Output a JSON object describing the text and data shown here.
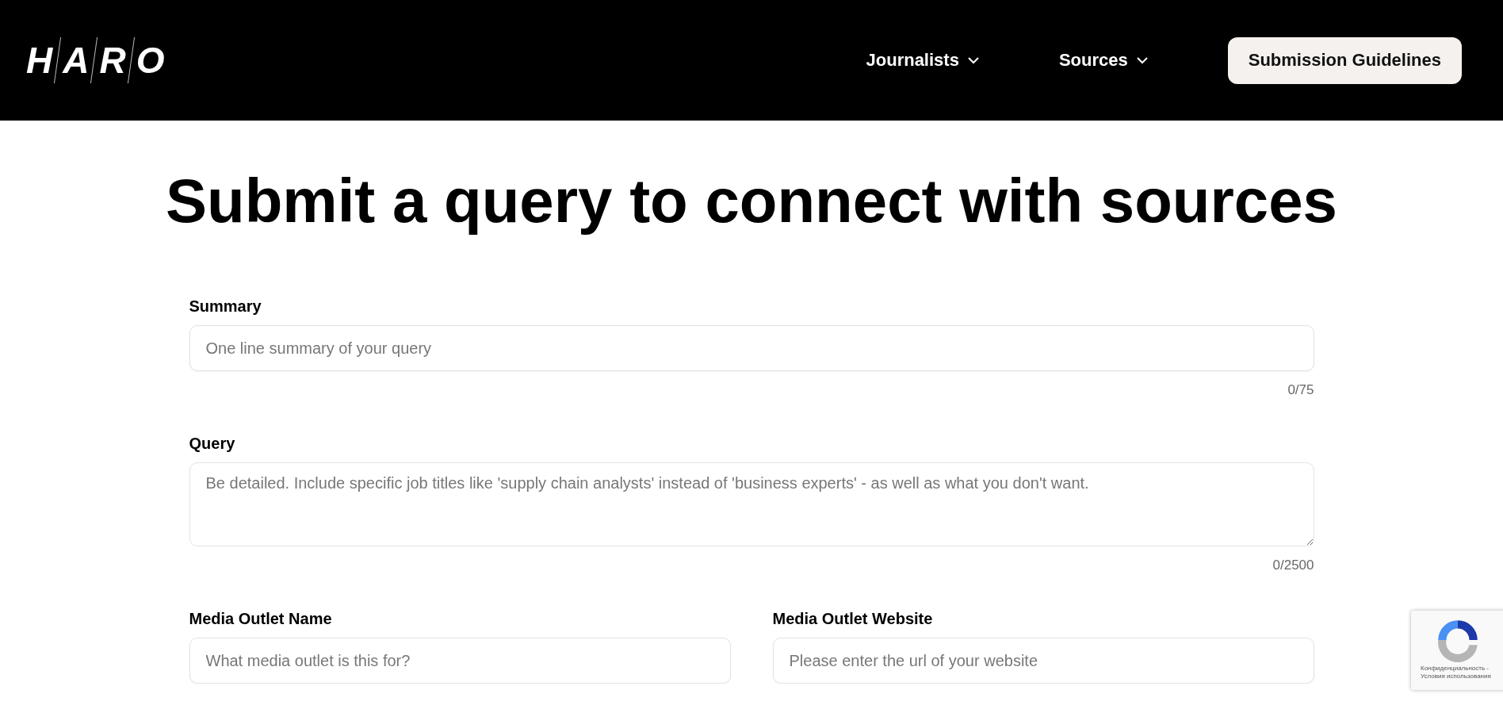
{
  "header": {
    "logo_letters": [
      "H",
      "A",
      "R",
      "O"
    ],
    "nav": [
      {
        "label": "Journalists",
        "kind": "dropdown"
      },
      {
        "label": "Sources",
        "kind": "dropdown"
      },
      {
        "label": "Submission Guidelines",
        "kind": "button"
      }
    ]
  },
  "title": "Submit a query to connect with sources",
  "fields": [
    {
      "kind": "input",
      "label": "Summary",
      "placeholder": "One line summary of your query",
      "counter": "0/75"
    },
    {
      "kind": "textarea",
      "label": "Query",
      "placeholder": "Be detailed. Include specific job titles like 'supply chain analysts' instead of 'business experts' - as well as what you don't want.",
      "counter": "0/2500"
    },
    {
      "kind": "pair",
      "items": [
        {
          "label": "Media Outlet Name",
          "placeholder": "What media outlet is this for?"
        },
        {
          "label": "Media Outlet Website",
          "placeholder": "Please enter the url of your website"
        }
      ]
    }
  ],
  "recaptcha": {
    "lines": [
      "Конфиденциальность -",
      "Условия использования"
    ]
  }
}
